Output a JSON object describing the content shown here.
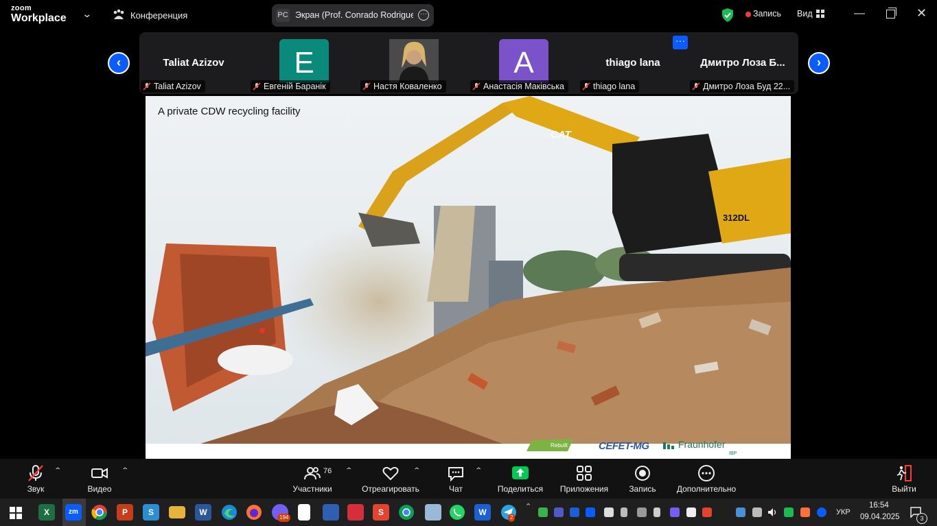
{
  "window": {
    "app_logo_line1": "zoom",
    "app_logo_line2": "Workplace",
    "meeting_title": "Конференция",
    "share_initials": "PC",
    "share_label": "Экран (Prof. Conrado Rodrigues",
    "record_label": "Запись",
    "view_label": "Вид"
  },
  "participants": [
    {
      "display": "Taliat Azizov",
      "name": "Taliat Azizov",
      "type": "text"
    },
    {
      "display": "E",
      "name": "Евгеній Баранік",
      "type": "letter",
      "color": "#0a8a7a"
    },
    {
      "display": "",
      "name": "Настя Коваленко",
      "type": "photo"
    },
    {
      "display": "A",
      "name": "Анастасія Маківська",
      "type": "letter",
      "color": "#7b52c9"
    },
    {
      "display": "thiago lana",
      "name": "thiago lana",
      "type": "text"
    },
    {
      "display": "Дмитро Лоза Б...",
      "name": "Дмитро Лоза Буд 22...",
      "type": "text"
    }
  ],
  "slide": {
    "title": "A private CDW recycling facility",
    "logo_rebuilt": "Rebuilt",
    "logo_cefet": "CEFET-MG",
    "logo_fraunhofer": "Fraunhofer",
    "logo_ibp": "IBP",
    "machine_brand": "CAT",
    "machine_model": "312DL"
  },
  "controls": {
    "audio": "Звук",
    "video": "Видео",
    "participants": "Участники",
    "participants_count": "76",
    "react": "Отреагировать",
    "chat": "Чат",
    "share": "Поделиться",
    "apps": "Приложения",
    "record": "Запись",
    "more": "Дополнительно",
    "leave": "Выйти"
  },
  "taskbar": {
    "viber_badge": "194",
    "telegram_badge": "2",
    "language": "УКР",
    "time": "16:54",
    "date": "09.04.2025",
    "notifications": "3"
  },
  "colors": {
    "accent_blue": "#0b5cff",
    "share_green": "#00c853",
    "record_red": "#ff3b30"
  }
}
